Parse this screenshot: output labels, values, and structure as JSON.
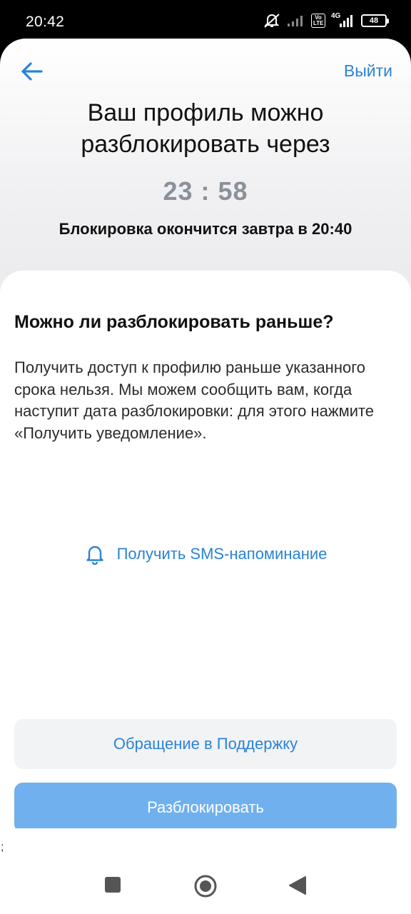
{
  "status_bar": {
    "time": "20:42",
    "network": "4G",
    "volte": "Vo LTE",
    "battery": "48",
    "icons": [
      "mute-icon",
      "signal-icon",
      "volte-icon",
      "network-4g-icon",
      "battery-icon"
    ]
  },
  "header": {
    "back_icon": "arrow-left-icon",
    "exit_label": "Выйти"
  },
  "main": {
    "title": "Ваш профиль можно разблокировать через",
    "timer": "23 : 58",
    "unlock_info": "Блокировка окончится завтра в 20:40"
  },
  "card": {
    "heading": "Можно ли разблокировать раньше?",
    "text": "Получить доступ к профилю раньше указанного срока нельзя. Мы можем сообщить вам, когда наступит дата разблокировки: для этого нажмите «Получить уведомление».",
    "sms_icon": "bell-icon",
    "sms_label": "Получить SMS-напоминание",
    "support_label": "Обращение в Поддержку",
    "unlock_label": "Разблокировать"
  },
  "stray_text": ";",
  "nav_bar": {
    "buttons": [
      "recents-square-icon",
      "home-circle-icon",
      "back-triangle-icon"
    ]
  },
  "colors": {
    "accent": "#2a83d6",
    "unlock_button": "#70b0ee",
    "timer": "#8a9199"
  }
}
